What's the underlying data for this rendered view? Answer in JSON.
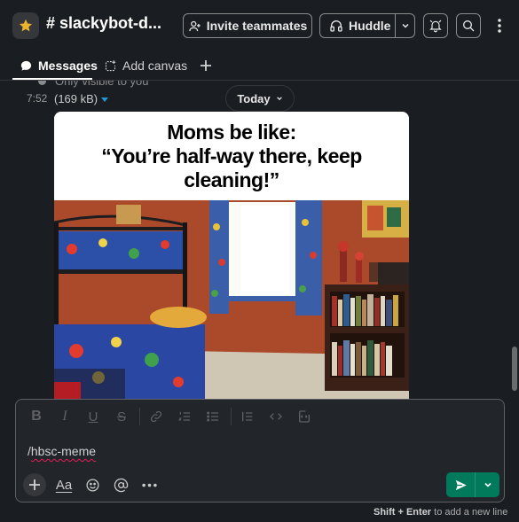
{
  "header": {
    "channel_name": "# slackybot-d...",
    "invite_label": "Invite teammates",
    "huddle_label": "Huddle"
  },
  "tabs": [
    {
      "label": "Messages",
      "active": true
    },
    {
      "label": "Add canvas",
      "active": false
    }
  ],
  "messages": {
    "cut_text": "Only visible to you",
    "time": "7:52",
    "file_size": "(169 kB)",
    "date_divider": "Today",
    "meme": {
      "caption_line1": "Moms be like:",
      "caption_line2": "“You’re half-way there, keep",
      "caption_line3": "cleaning!”"
    }
  },
  "composer": {
    "input_value": "/hbsc-meme",
    "format_label": "Aa"
  },
  "hint": {
    "keys": "Shift + Enter",
    "text": " to add a new line"
  },
  "colors": {
    "background": "#1a1d21",
    "send_green": "#007a5a",
    "star": "#ecb22e",
    "accent_blue": "#1d9bd1"
  }
}
